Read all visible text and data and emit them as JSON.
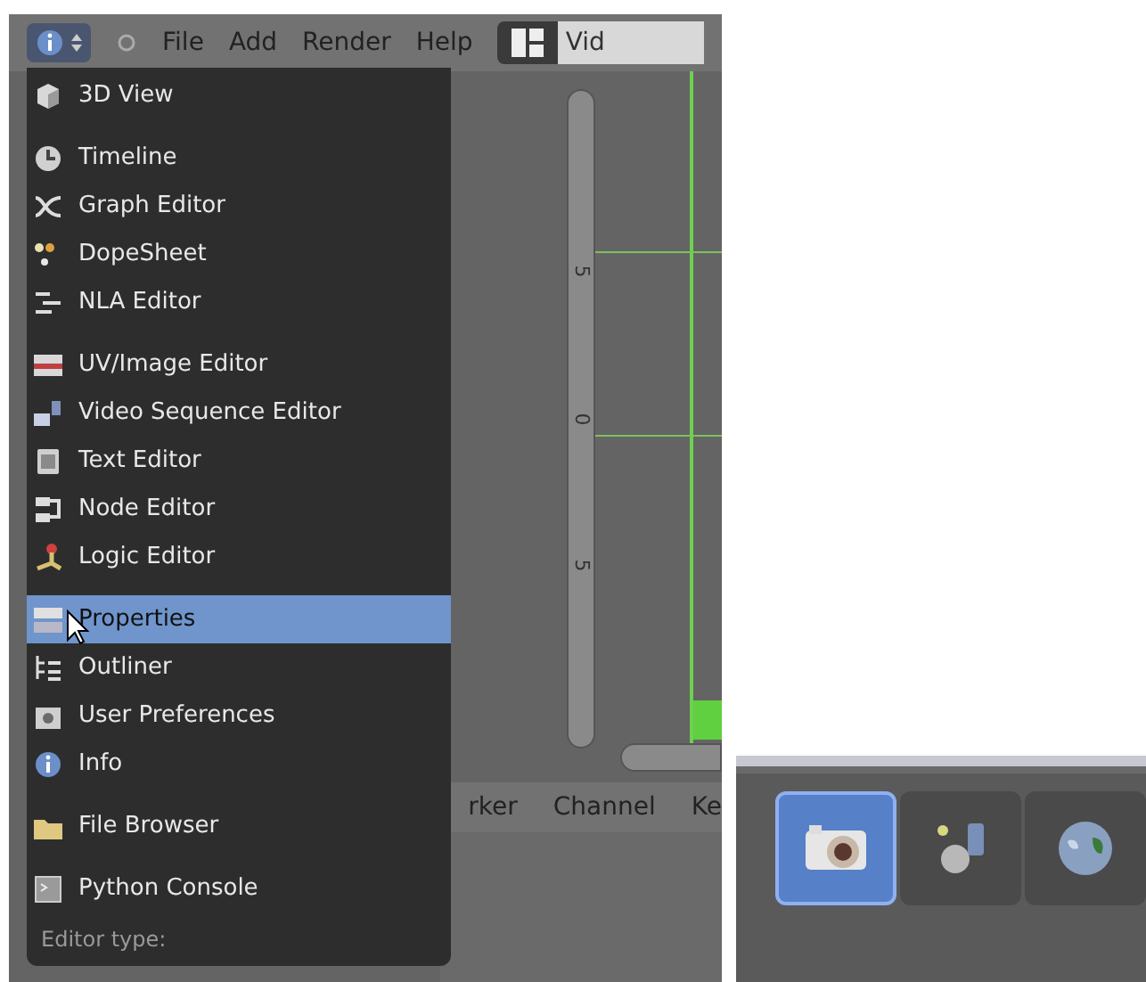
{
  "header": {
    "menus": [
      "File",
      "Add",
      "Render",
      "Help"
    ],
    "screen_field": "Vid"
  },
  "editor_menu": {
    "groups": [
      [
        {
          "label": "3D View",
          "kind": "cube",
          "selected": false
        }
      ],
      [
        {
          "label": "Timeline",
          "kind": "clock",
          "selected": false
        },
        {
          "label": "Graph Editor",
          "kind": "curve",
          "selected": false
        },
        {
          "label": "DopeSheet",
          "kind": "dopesheet",
          "selected": false
        },
        {
          "label": "NLA Editor",
          "kind": "nla",
          "selected": false
        }
      ],
      [
        {
          "label": "UV/Image Editor",
          "kind": "image",
          "selected": false
        },
        {
          "label": "Video Sequence Editor",
          "kind": "sequence",
          "selected": false
        },
        {
          "label": "Text Editor",
          "kind": "text",
          "selected": false
        },
        {
          "label": "Node Editor",
          "kind": "node",
          "selected": false
        },
        {
          "label": "Logic Editor",
          "kind": "logic",
          "selected": false
        }
      ],
      [
        {
          "label": "Properties",
          "kind": "properties",
          "selected": true
        },
        {
          "label": "Outliner",
          "kind": "outliner",
          "selected": false
        },
        {
          "label": "User Preferences",
          "kind": "prefs",
          "selected": false
        },
        {
          "label": "Info",
          "kind": "info",
          "selected": false
        }
      ],
      [
        {
          "label": "File Browser",
          "kind": "folder",
          "selected": false
        }
      ],
      [
        {
          "label": "Python Console",
          "kind": "console",
          "selected": false
        }
      ]
    ],
    "footer": "Editor type:"
  },
  "graph": {
    "axis_labels": [
      "5",
      "0",
      "5"
    ]
  },
  "bottom_header": {
    "menus": [
      "rker",
      "Channel",
      "Ke"
    ]
  },
  "properties_tabs": [
    {
      "kind": "camera",
      "selected": true
    },
    {
      "kind": "layers",
      "selected": false
    },
    {
      "kind": "world",
      "selected": false
    }
  ]
}
